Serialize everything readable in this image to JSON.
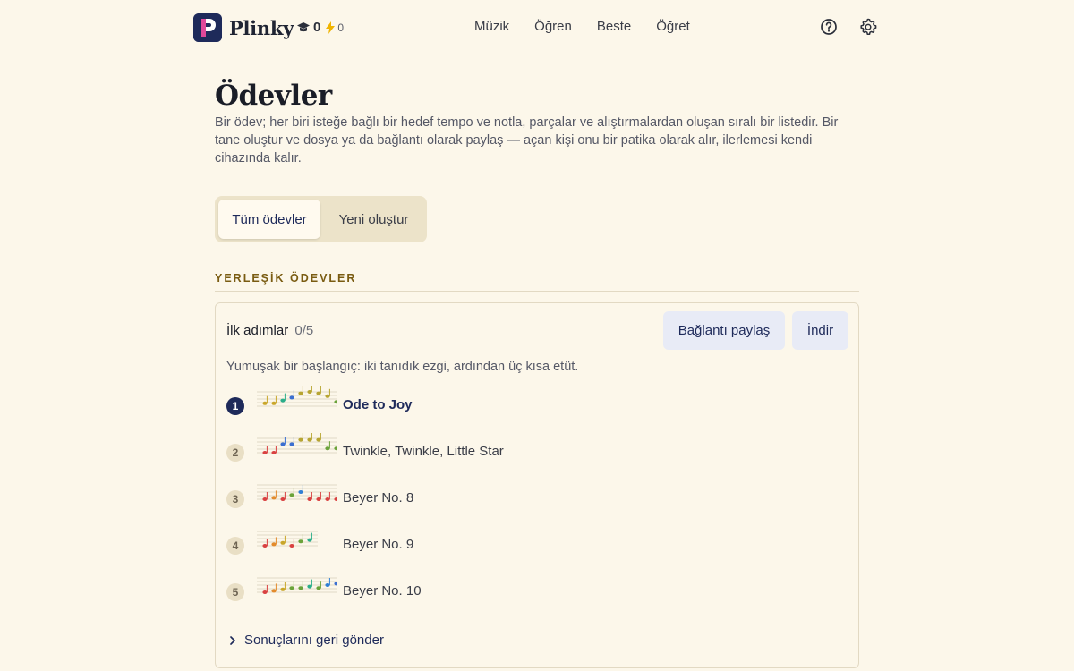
{
  "header": {
    "app_name": "Plinky",
    "logo_letter": "P",
    "stats": {
      "graduation": "0",
      "lightning": "0"
    },
    "nav": [
      "Müzik",
      "Öğren",
      "Beste",
      "Öğret"
    ]
  },
  "page": {
    "title": "Ödevler",
    "description": "Bir ödev; her biri isteğe bağlı bir hedef tempo ve notla, parçalar ve alıştırmalardan oluşan sıralı bir listedir. Bir tane oluştur ve dosya ya da bağlantı olarak paylaş — açan kişi onu bir patika olarak alır, ilerlemesi kendi cihazında kalır."
  },
  "tabs": {
    "all": "Tüm ödevler",
    "create": "Yeni oluştur",
    "selected": "all"
  },
  "section": {
    "label": "YERLEŞİK ÖDEVLER"
  },
  "assignment": {
    "title": "İlk adımlar",
    "progress": "0/5",
    "description": "Yumuşak bir başlangıç: iki tanıdık ezgi, ardından üç kısa etüt.",
    "share_label": "Bağlantı paylaş",
    "download_label": "İndir",
    "items": [
      {
        "number": "1",
        "title": "Ode to Joy",
        "state": "current"
      },
      {
        "number": "2",
        "title": "Twinkle, Twinkle, Little Star",
        "state": "pending"
      },
      {
        "number": "3",
        "title": "Beyer No. 8",
        "state": "pending"
      },
      {
        "number": "4",
        "title": "Beyer No. 9",
        "state": "pending"
      },
      {
        "number": "5",
        "title": "Beyer No. 10",
        "state": "pending"
      }
    ],
    "send_back_label": "Sonuçlarını geri gönder"
  },
  "colors": {
    "background": "#fcf7ea",
    "primary": "#1e2a5a",
    "accent_label": "#7a5c12",
    "button_bg": "#e8ebf6",
    "note_palette": [
      "#d94141",
      "#e38b2c",
      "#c9a629",
      "#6ba33a",
      "#2bae8a",
      "#2f7fd4",
      "#3b6fd1",
      "#b7a532"
    ]
  }
}
